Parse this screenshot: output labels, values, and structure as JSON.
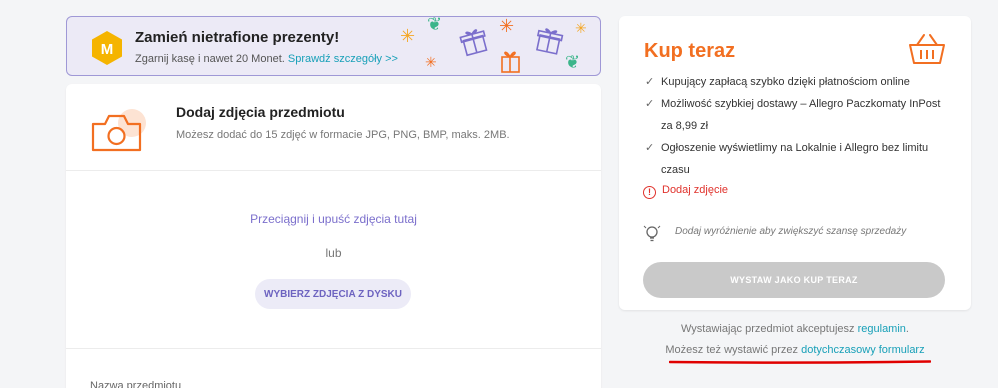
{
  "promo": {
    "title": "Zamień nietrafione prezenty!",
    "subtitle": "Zgarnij kasę i nawet 20 Monet.",
    "link": "Sprawdź szczegóły >>",
    "logo_letter": "M",
    "logo_color": "#f5b400"
  },
  "photos": {
    "title": "Dodaj zdjęcia przedmiotu",
    "description": "Możesz dodać do 15 zdjęć w formacie JPG, PNG, BMP, maks. 2MB.",
    "drop_text": "Przeciągnij i upuść zdjęcia tutaj",
    "or_text": "lub",
    "choose_button": "WYBIERZ ZDJĘCIA Z DYSKU",
    "icon": "camera-icon"
  },
  "form": {
    "name_label": "Nazwa przedmiotu"
  },
  "buy_now": {
    "title": "Kup teraz",
    "icon": "basket-icon",
    "features": [
      "Kupujący zapłacą szybko dzięki płatnościom online",
      "Możliwość szybkiej dostawy – Allegro Paczkomaty InPost za 8,99 zł",
      "Ogłoszenie wyświetlimy na Lokalnie i Allegro bez limitu czasu"
    ],
    "warning": "Dodaj zdjęcie",
    "hint": "Dodaj wyróżnienie aby zwiększyć szansę sprzedaży",
    "publish_button": "WYSTAW JAKO KUP TERAZ"
  },
  "footer": {
    "accept_text": "Wystawiając przedmiot akceptujesz",
    "accept_link": "regulamin",
    "alt_text": "Możesz też wystawić przez",
    "alt_link": "dotychczasowy formularz"
  },
  "colors": {
    "accent_orange": "#f26f21",
    "link_teal": "#18a0b8",
    "purple": "#7b6fcc",
    "warning_red": "#e0322c",
    "annotation_red": "#e00000"
  }
}
